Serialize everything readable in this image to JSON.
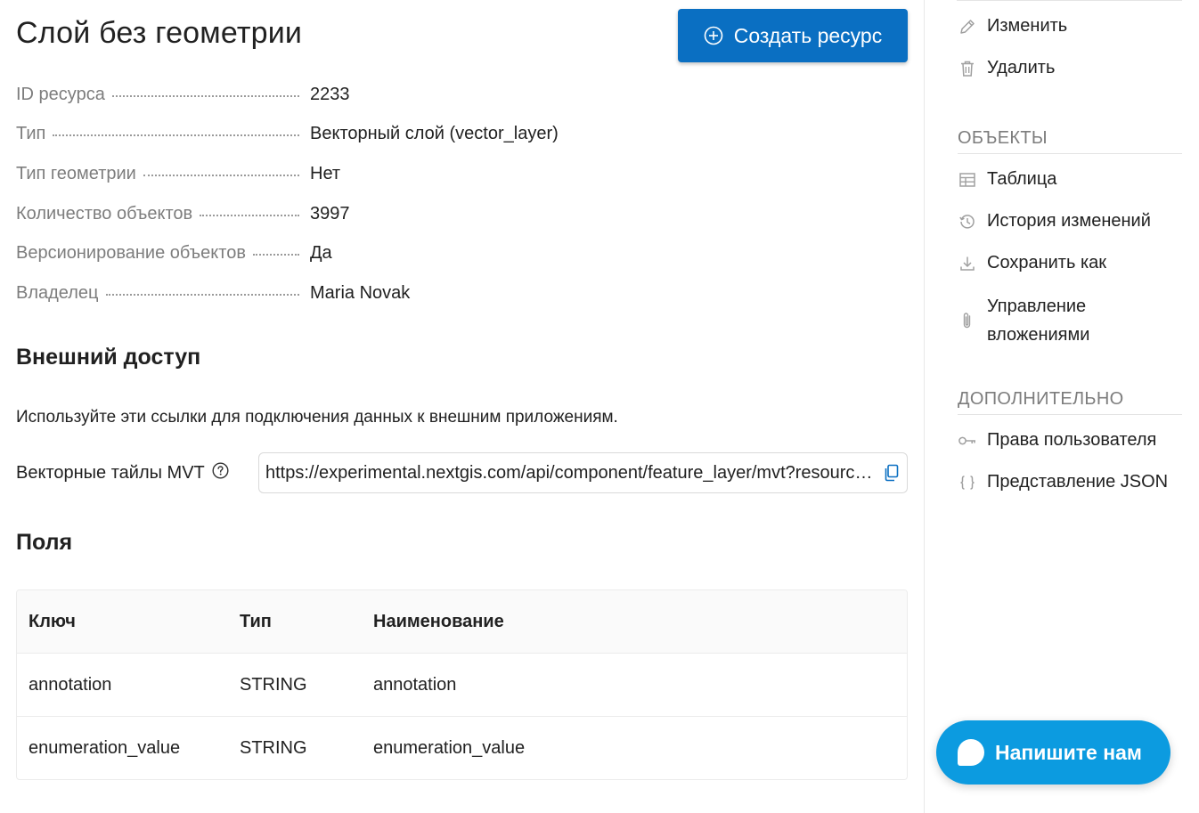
{
  "header": {
    "title": "Слой без геометрии",
    "create_button": "Создать ресурс"
  },
  "properties": [
    {
      "key": "ID ресурса",
      "value": "2233"
    },
    {
      "key": "Тип",
      "value": "Векторный слой (vector_layer)"
    },
    {
      "key": "Тип геометрии",
      "value": "Нет"
    },
    {
      "key": "Количество объектов",
      "value": "3997"
    },
    {
      "key": "Версионирование объектов",
      "value": "Да"
    },
    {
      "key": "Владелец",
      "value": "Maria Novak"
    }
  ],
  "external_access": {
    "heading": "Внешний доступ",
    "description": "Используйте эти ссылки для подключения данных к внешним приложениям.",
    "mvt_label": "Векторные тайлы MVT",
    "mvt_url": "https://experimental.nextgis.com/api/component/feature_layer/mvt?resource=2233&z={z}&x={x}&y={y}"
  },
  "fields": {
    "heading": "Поля",
    "columns": [
      "Ключ",
      "Тип",
      "Наименование"
    ],
    "rows": [
      [
        "annotation",
        "STRING",
        "annotation"
      ],
      [
        "enumeration_value",
        "STRING",
        "enumeration_value"
      ]
    ]
  },
  "sidebar": {
    "actions": [
      {
        "label": "Изменить",
        "icon": "pencil-icon"
      },
      {
        "label": "Удалить",
        "icon": "trash-icon"
      }
    ],
    "objects_heading": "ОБЪЕКТЫ",
    "objects": [
      {
        "label": "Таблица",
        "icon": "table-icon"
      },
      {
        "label": "История изменений",
        "icon": "history-icon"
      },
      {
        "label": "Сохранить как",
        "icon": "download-icon"
      },
      {
        "label": "Управление вложениями",
        "icon": "paperclip-icon"
      }
    ],
    "extra_heading": "ДОПОЛНИТЕЛЬНО",
    "extra": [
      {
        "label": "Права пользователя",
        "icon": "key-icon"
      },
      {
        "label": "Представление JSON",
        "icon": "braces-icon"
      }
    ]
  },
  "chat": {
    "label": "Напишите нам"
  },
  "colors": {
    "primary": "#0a6fc2",
    "chat": "#0c9be0",
    "muted_text": "#7d7d7d",
    "icon_gray": "#a0a0a0"
  }
}
